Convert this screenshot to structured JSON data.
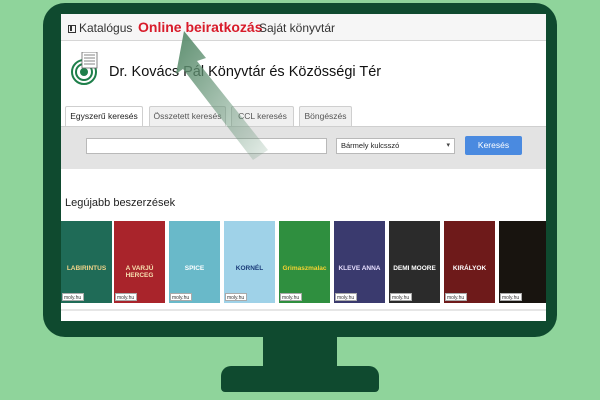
{
  "nav": {
    "catalog_label": "Katalógus",
    "online_label": "Online beiratkozás",
    "mylibrary_label": "Saját könyvtár"
  },
  "library": {
    "title": "Dr. Kovács Pál Könyvtár és Közösségi Tér"
  },
  "tabs": [
    {
      "label": "Egyszerű keresés",
      "active": true
    },
    {
      "label": "Összetett keresés",
      "active": false
    },
    {
      "label": "CCL keresés",
      "active": false
    },
    {
      "label": "Böngészés",
      "active": false
    }
  ],
  "search": {
    "input_value": "",
    "select_value": "Bármely kulcsszó",
    "button_label": "Keresés"
  },
  "recent": {
    "heading": "Legújabb beszerzések",
    "badge": "moly.hu",
    "books": [
      {
        "cover_title": "LABIRINTUS",
        "bg": "#1f6b57",
        "fg": "#f2d48a"
      },
      {
        "cover_title": "A VARJÚ HERCEG",
        "bg": "#a9242b",
        "fg": "#f7e0b0"
      },
      {
        "cover_title": "SPICE",
        "bg": "#69b9c9",
        "fg": "#ffffff"
      },
      {
        "cover_title": "KORNÉL",
        "bg": "#9fd2e8",
        "fg": "#1a3b78"
      },
      {
        "cover_title": "Grimaszmalac",
        "bg": "#2f8f3f",
        "fg": "#f7d331"
      },
      {
        "cover_title": "KLEVE ANNA",
        "bg": "#3a3a6e",
        "fg": "#e7dfff"
      },
      {
        "cover_title": "DEMI MOORE",
        "bg": "#2b2b2b",
        "fg": "#ffffff"
      },
      {
        "cover_title": "KIRÁLYOK",
        "bg": "#6e1a1a",
        "fg": "#ffffff"
      },
      {
        "cover_title": "",
        "bg": "#18140f",
        "fg": "#d8c79a"
      }
    ]
  },
  "colors": {
    "background": "#8fd49b",
    "monitor": "#0f4a2f",
    "accent_red": "#d81b2a",
    "button_blue": "#4a8ae0"
  }
}
